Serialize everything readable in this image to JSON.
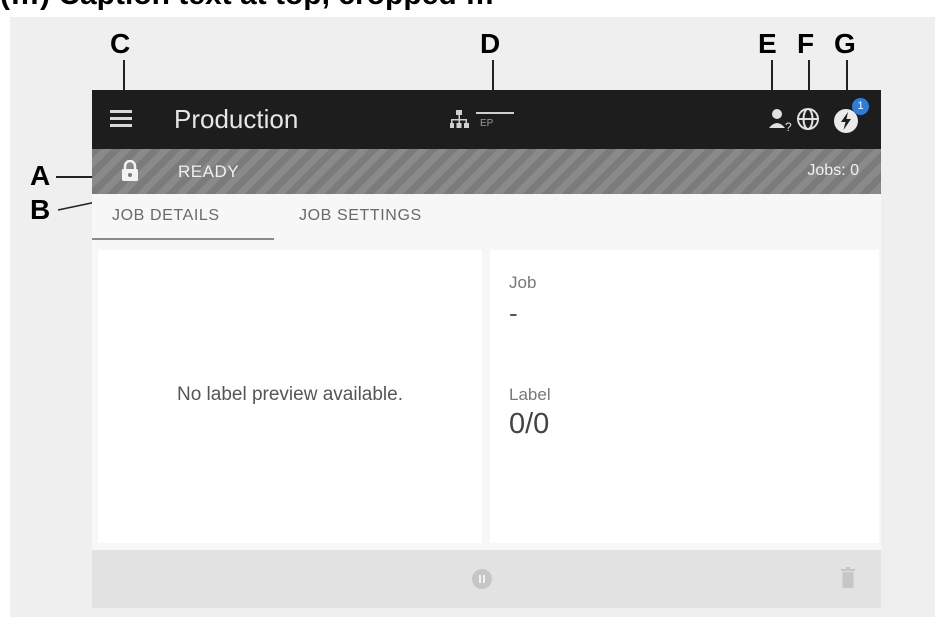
{
  "header_cut_text": "(…) Caption text at top, cropped …",
  "callouts": {
    "a": "A",
    "b": "B",
    "c": "C",
    "d": "D",
    "e": "E",
    "f": "F",
    "g": "G"
  },
  "topbar": {
    "title": "Production",
    "network_badge": "EP",
    "notification_count": "1"
  },
  "status": {
    "state": "READY",
    "jobs": "Jobs: 0"
  },
  "tabs": [
    {
      "label": "JOB DETAILS",
      "active": true
    },
    {
      "label": "JOB SETTINGS",
      "active": false
    }
  ],
  "preview": {
    "message": "No label preview available."
  },
  "details": {
    "job_label": "Job",
    "job_value": "-",
    "label_label": "Label",
    "label_value": "0/0"
  },
  "icons": {
    "menu": "menu-icon",
    "network": "network-icon",
    "user": "user-help-icon",
    "language": "globe-icon",
    "notifications": "lightning-icon",
    "lock": "lock-icon",
    "pause": "pause-icon",
    "delete": "trash-icon"
  },
  "colors": {
    "topbar": "#1d1d1d",
    "notification_badge": "#2a7ee0",
    "status_stripe": "#7b7b7b"
  }
}
